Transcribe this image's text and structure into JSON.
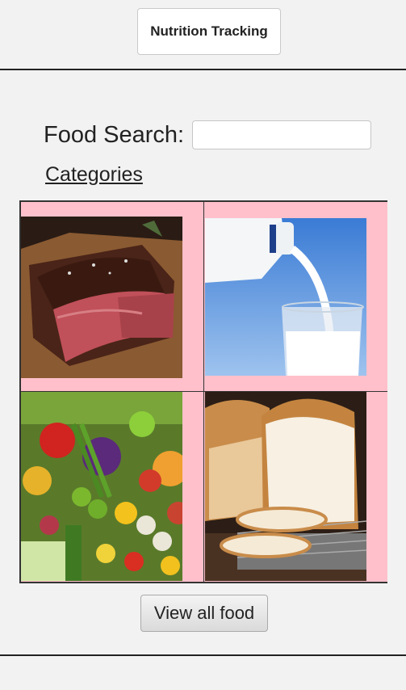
{
  "header": {
    "title": "Nutrition Tracking"
  },
  "search": {
    "label": "Food Search:",
    "value": ""
  },
  "categories": {
    "link_label": "Categories",
    "items": [
      {
        "name": "meat",
        "icon": "steak-image"
      },
      {
        "name": "dairy",
        "icon": "milk-image"
      },
      {
        "name": "vegetables",
        "icon": "vegetables-image"
      },
      {
        "name": "grains",
        "icon": "bread-image"
      }
    ]
  },
  "actions": {
    "view_all_label": "View all food"
  },
  "colors": {
    "tile_background": "#ffc0cb",
    "page_background": "#f2f2f2"
  }
}
